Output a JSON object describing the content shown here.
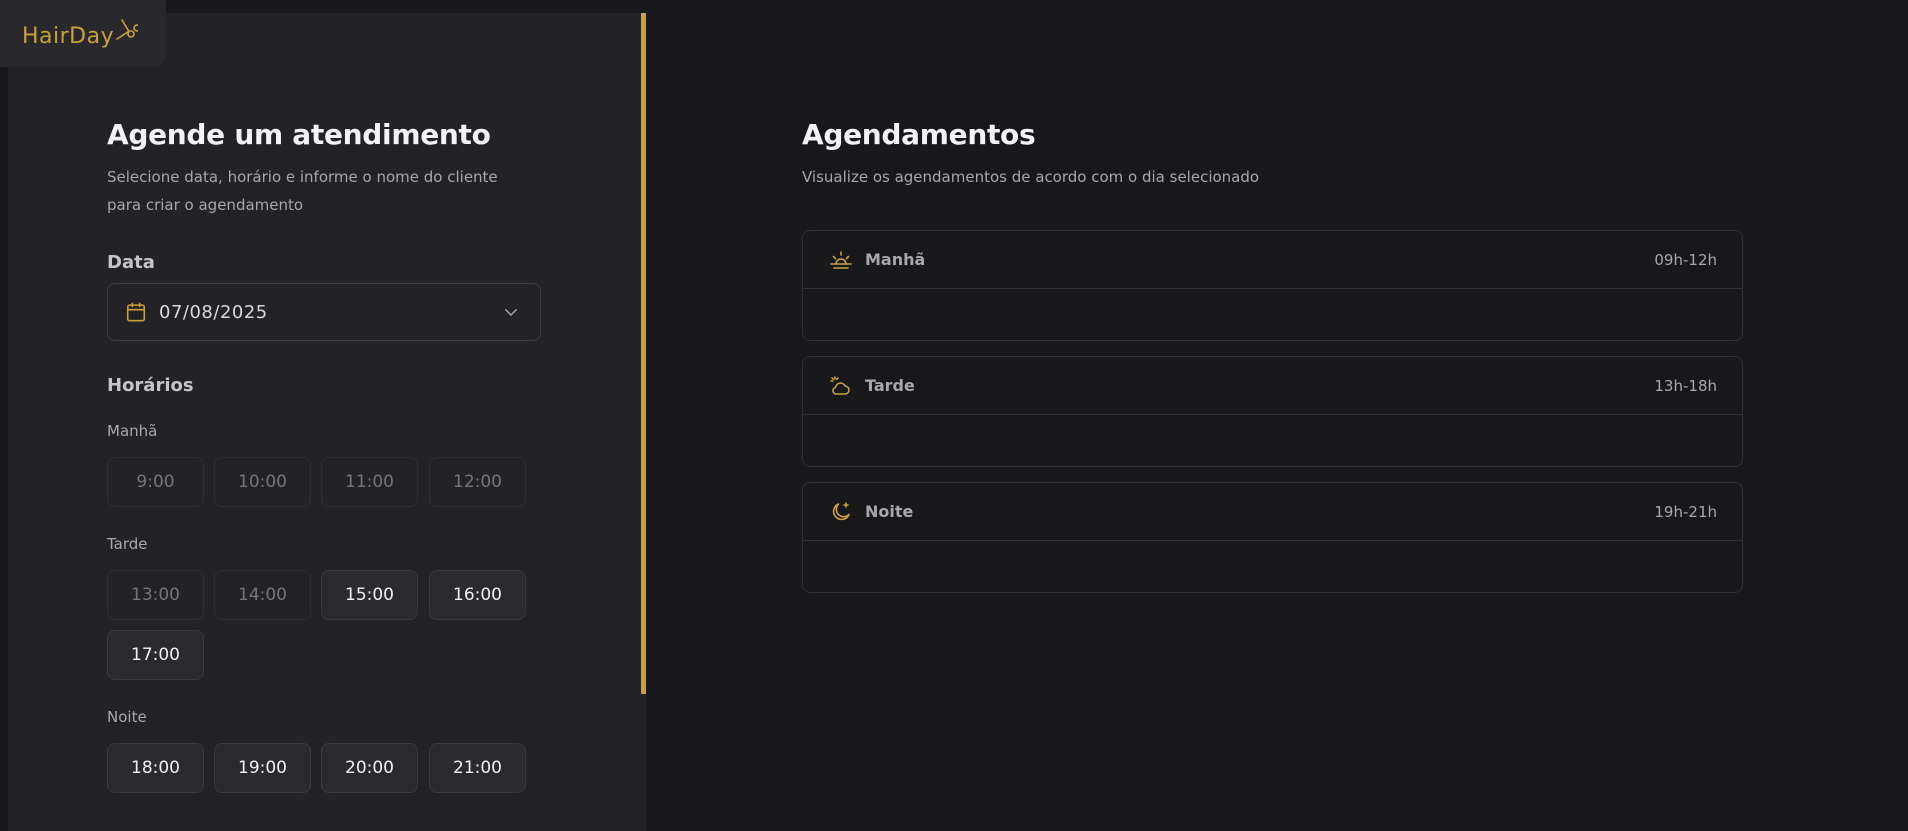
{
  "logo": {
    "text": "HairDay"
  },
  "form": {
    "title": "Agende um atendimento",
    "subtitle": "Selecione data, horário e informe o nome do cliente para criar o agendamento",
    "date_label": "Data",
    "date_value": "07/08/2025",
    "times_label": "Horários",
    "periods": [
      {
        "name": "Manhã",
        "slots": [
          {
            "time": "9:00",
            "available": false
          },
          {
            "time": "10:00",
            "available": false
          },
          {
            "time": "11:00",
            "available": false
          },
          {
            "time": "12:00",
            "available": false
          }
        ]
      },
      {
        "name": "Tarde",
        "slots": [
          {
            "time": "13:00",
            "available": false
          },
          {
            "time": "14:00",
            "available": false
          },
          {
            "time": "15:00",
            "available": true
          },
          {
            "time": "16:00",
            "available": true
          },
          {
            "time": "17:00",
            "available": true
          }
        ]
      },
      {
        "name": "Noite",
        "slots": [
          {
            "time": "18:00",
            "available": true
          },
          {
            "time": "19:00",
            "available": true
          },
          {
            "time": "20:00",
            "available": true
          },
          {
            "time": "21:00",
            "available": true
          }
        ]
      }
    ]
  },
  "schedule": {
    "title": "Agendamentos",
    "subtitle": "Visualize os agendamentos de acordo com o dia selecionado",
    "periods": [
      {
        "name": "Manhã",
        "range": "09h-12h",
        "icon": "sunrise-icon"
      },
      {
        "name": "Tarde",
        "range": "13h-18h",
        "icon": "cloud-sun-icon"
      },
      {
        "name": "Noite",
        "range": "19h-21h",
        "icon": "moon-stars-icon"
      }
    ]
  },
  "colors": {
    "accent": "#c9a13a",
    "background": "#18171a",
    "panel": "#232226"
  }
}
